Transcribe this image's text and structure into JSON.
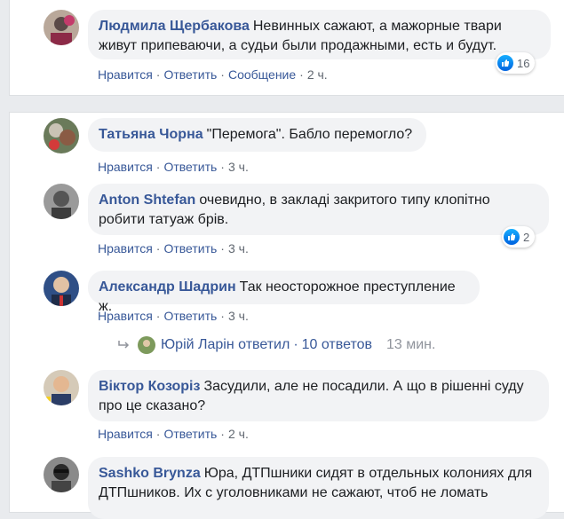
{
  "actions": {
    "like": "Нравится",
    "reply": "Ответить",
    "message": "Сообщение"
  },
  "comments_top": [
    {
      "author": "Людмила Щербакова",
      "text": "Невинных сажают, а мажорные твари живут припеваючи, а судьи были продажными, есть и будут.",
      "time": "2 ч.",
      "likes": "16"
    }
  ],
  "comments": [
    {
      "author": "Татьяна Чорна",
      "text": "\"Перемога\". Бабло перемогло?",
      "time": "3 ч."
    },
    {
      "author": "Anton Shtefan",
      "text": "очевидно, в закладі закритого типу клопітно робити татуаж брів.",
      "time": "3 ч.",
      "likes": "2"
    },
    {
      "author": "Александр Шадрин",
      "text": "Так неосторожное преступление ж.",
      "time": "3 ч."
    },
    {
      "author": "Віктор Козоріз",
      "text": "Засудили, але не посадили. А що в рішенні суду про це сказано?",
      "time": "2 ч."
    },
    {
      "author": "Sashko Brynza",
      "text": "Юра, ДТПшники сидят в отдельных колониях для ДТПшников. Их с уголовниками не сажают, чтоб не ломать",
      "time": ""
    }
  ],
  "replies_row": {
    "user": "Юрій Ларін",
    "verb": "ответил",
    "count": "10 ответов",
    "time": "13 мин."
  },
  "colors": {
    "link": "#385898",
    "bubble": "#f2f3f5",
    "like": "#0062df"
  }
}
